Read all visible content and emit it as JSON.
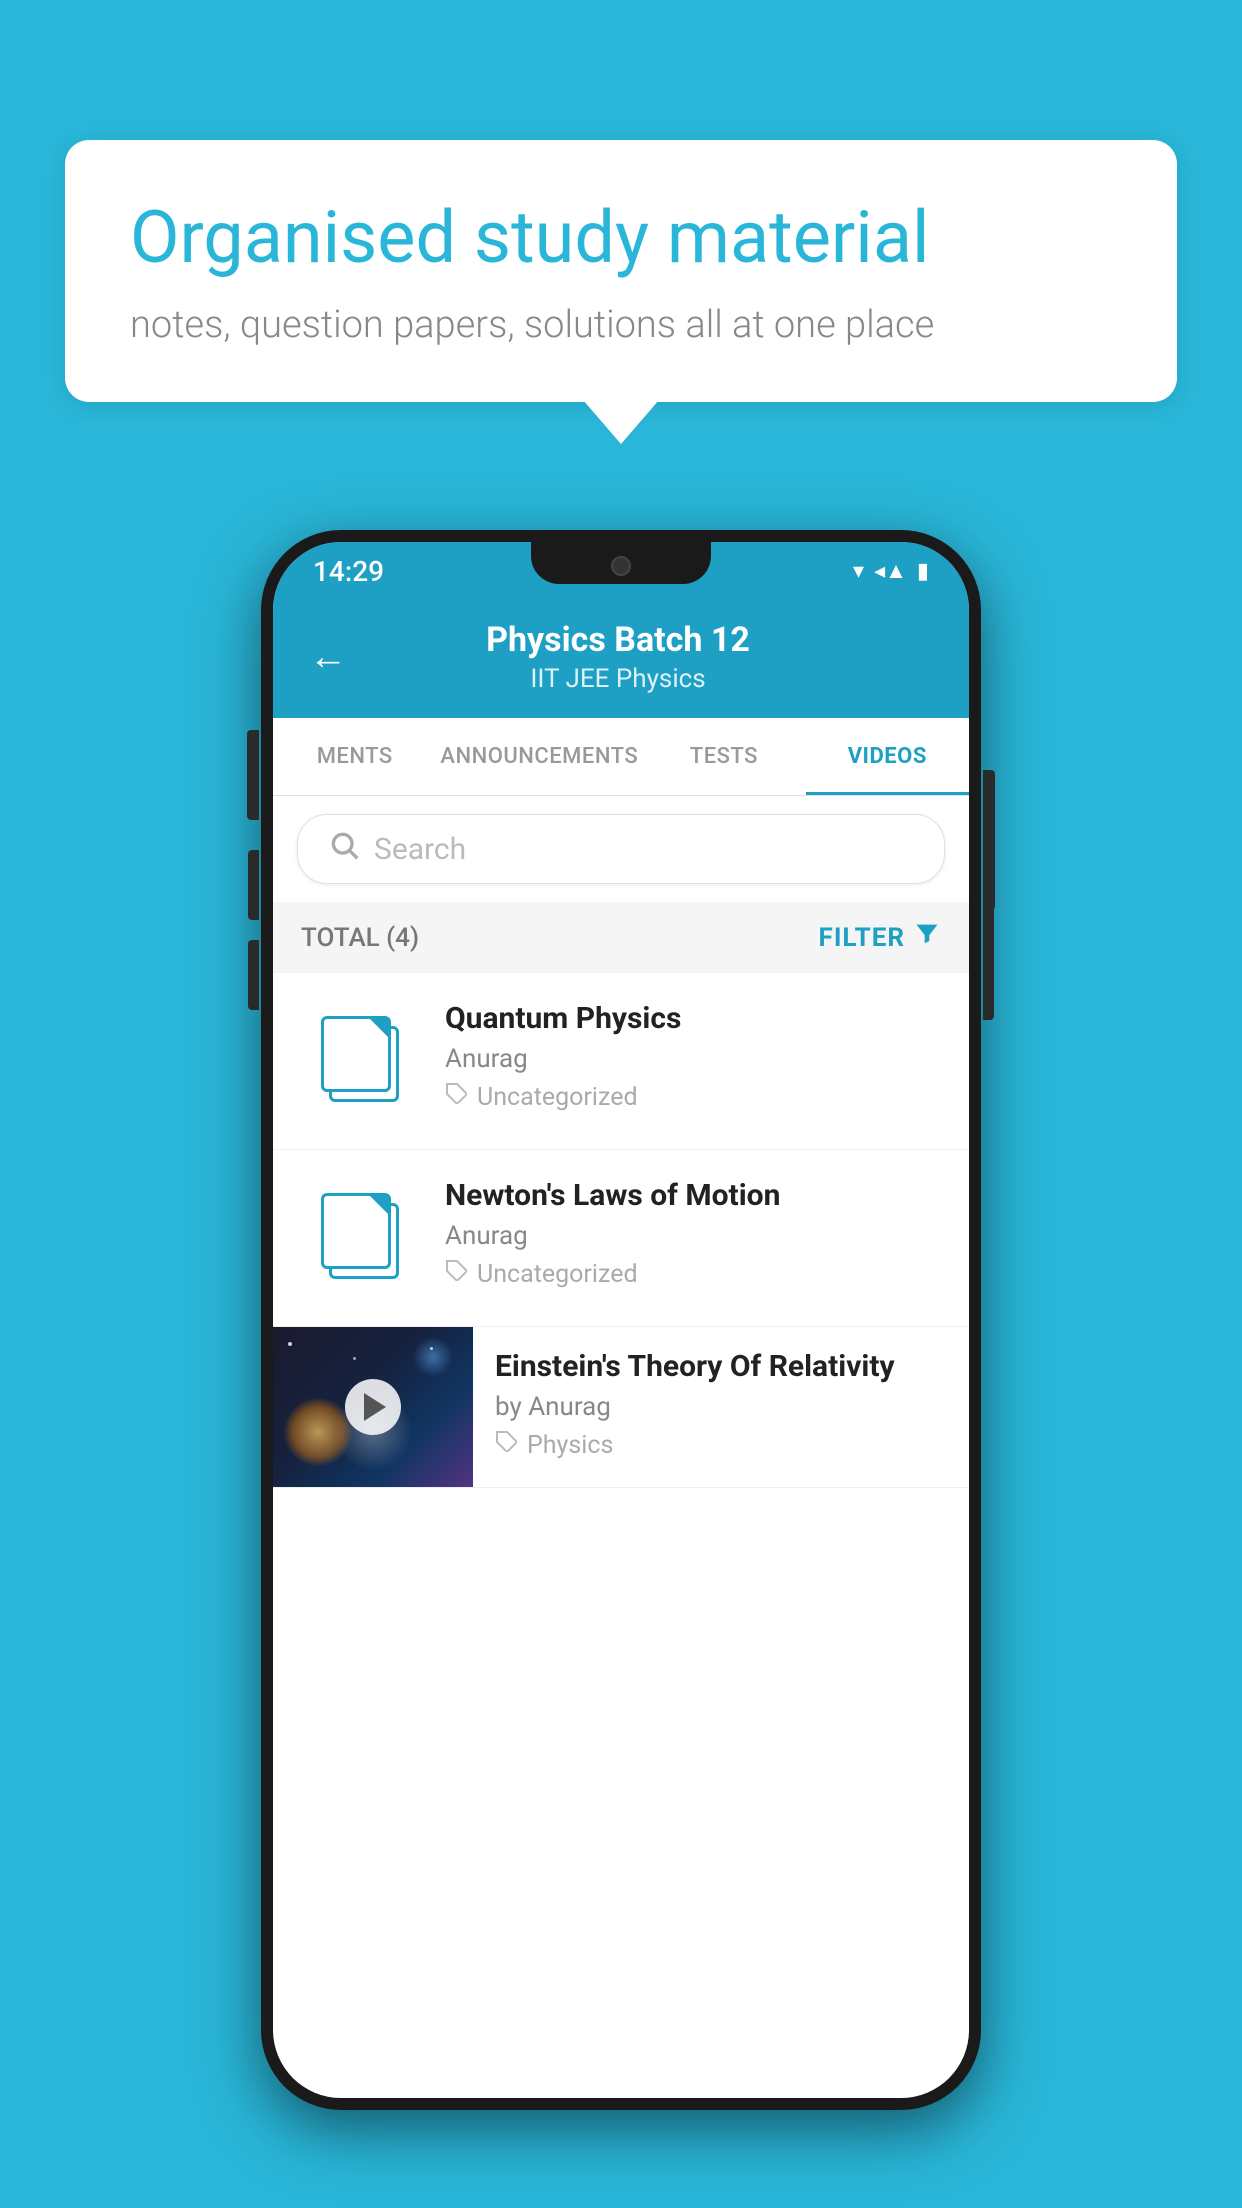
{
  "background_color": "#29b6d8",
  "speech_bubble": {
    "title": "Organised study material",
    "subtitle": "notes, question papers, solutions all at one place"
  },
  "phone": {
    "status_bar": {
      "time": "14:29",
      "icons": [
        "wifi",
        "signal",
        "battery"
      ]
    },
    "header": {
      "back_label": "←",
      "title": "Physics Batch 12",
      "subtitle": "IIT JEE    Physics"
    },
    "tabs": [
      {
        "label": "MENTS",
        "active": false
      },
      {
        "label": "ANNOUNCEMENTS",
        "active": false
      },
      {
        "label": "TESTS",
        "active": false
      },
      {
        "label": "VIDEOS",
        "active": true
      }
    ],
    "search": {
      "placeholder": "Search"
    },
    "filter_bar": {
      "total_label": "TOTAL (4)",
      "filter_label": "FILTER"
    },
    "videos": [
      {
        "id": 1,
        "title": "Quantum Physics",
        "author": "Anurag",
        "tag": "Uncategorized",
        "has_thumbnail": false
      },
      {
        "id": 2,
        "title": "Newton's Laws of Motion",
        "author": "Anurag",
        "tag": "Uncategorized",
        "has_thumbnail": false
      },
      {
        "id": 3,
        "title": "Einstein's Theory Of Relativity",
        "author": "by Anurag",
        "tag": "Physics",
        "has_thumbnail": true
      }
    ]
  }
}
